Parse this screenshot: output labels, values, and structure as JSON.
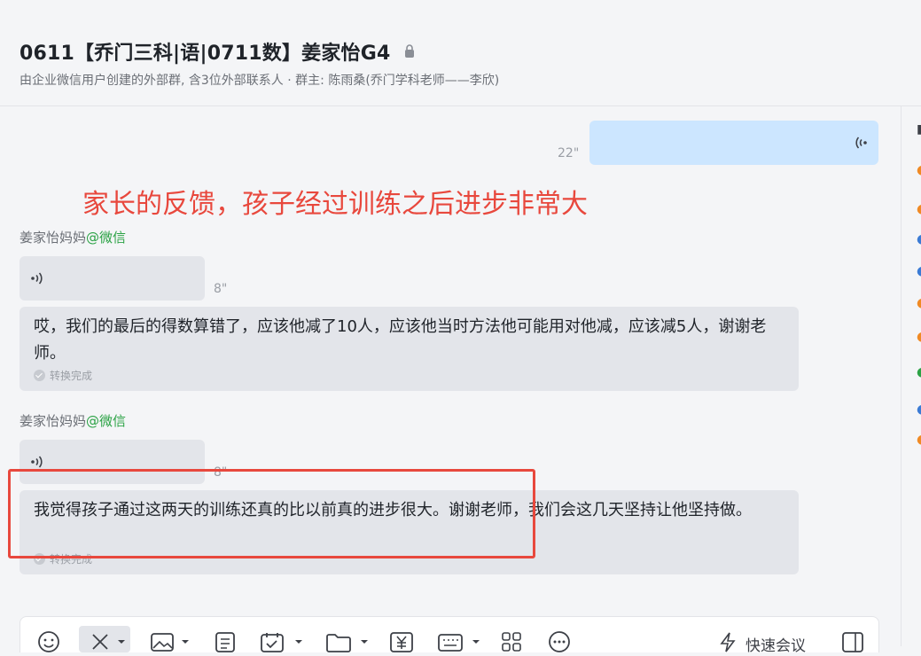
{
  "header": {
    "title": "0611【乔门三科|语|0711数】姜家怡G4",
    "subtitle": "由企业微信用户创建的外部群, 含3位外部联系人 · 群主: 陈雨桑(乔门学科老师——李欣)"
  },
  "messages": {
    "outgoing_voice": {
      "duration": "22\""
    },
    "annotation": "家长的反馈，孩子经过训练之后进步非常大",
    "group1": {
      "sender_name": "姜家怡妈妈",
      "sender_tag": "@微信",
      "voice_duration": "8\"",
      "transcript": "哎，我们的最后的得数算错了，应该他减了10人，应该他当时方法他可能用对他减，应该减5人，谢谢老师。",
      "status": "转换完成"
    },
    "group2": {
      "sender_name": "姜家怡妈妈",
      "sender_tag": "@微信",
      "voice_duration": "8\"",
      "transcript": "我觉得孩子通过这两天的训练还真的比以前真的进步很大。谢谢老师，我们会这几天坚持让他坚持做。",
      "status": "转换完成"
    }
  },
  "toolbar": {
    "icons": [
      "emoji-icon",
      "scissors-icon",
      "image-icon",
      "document-icon",
      "calendar-icon",
      "folder-icon",
      "yen-icon",
      "keyboard-icon",
      "apps-icon",
      "more-chat-icon"
    ],
    "quick_meeting_label": "快速会议"
  },
  "colors": {
    "accent_red": "#e8483d",
    "wechat_green": "#2ba245",
    "outgoing_bubble": "#cce6ff",
    "incoming_bubble": "#e3e5ea"
  }
}
